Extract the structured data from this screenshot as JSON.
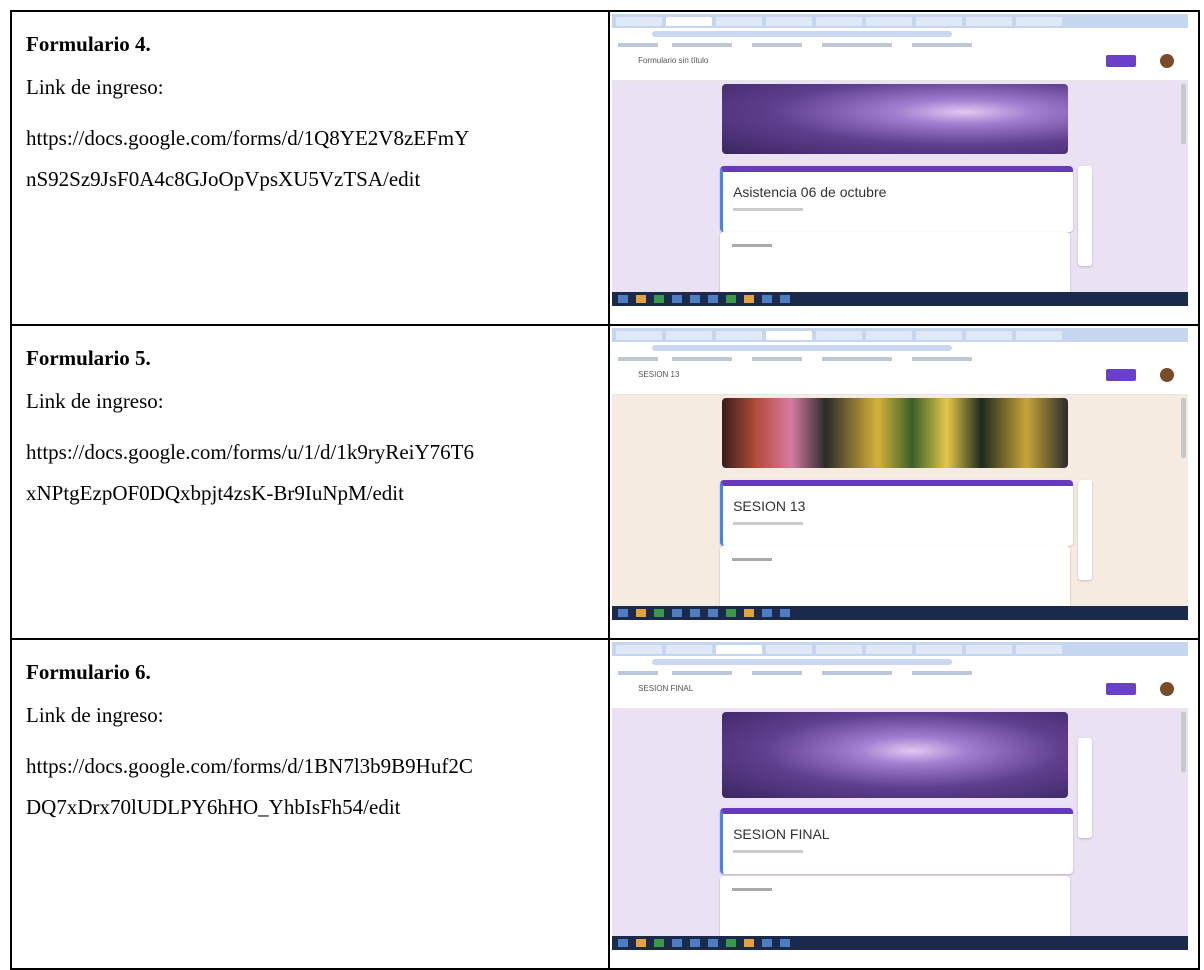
{
  "rows": [
    {
      "title": "Formulario 4.",
      "label": "Link de ingreso:",
      "url_line1": "https://docs.google.com/forms/d/1Q8YE2V8zEFmY",
      "url_line2": "nS92Sz9JsF0A4c8GJoOpVpsXU5VzTSA/edit",
      "screenshot": {
        "form_title": "Formulario sin título",
        "card_title": "Asistencia 06 de octubre",
        "background": "#eae1f3",
        "banner": "violet-flower"
      }
    },
    {
      "title": "Formulario 5.",
      "label": "Link de ingreso:",
      "url_line1": "https://docs.google.com/forms/u/1/d/1k9ryReiY76T6",
      "url_line2": "xNPtgEzpOF0DQxbpjt4zsK-Br9IuNpM/edit",
      "screenshot": {
        "form_title": "SESION 13",
        "card_title": "SESION 13",
        "background": "#f6ebe1",
        "banner": "colored-pencils"
      }
    },
    {
      "title": "Formulario 6.",
      "label": "Link de ingreso:",
      "url_line1": "https://docs.google.com/forms/d/1BN7l3b9B9Huf2C",
      "url_line2": "DQ7xDrx70lUDLPY6hHO_YhbIsFh54/edit",
      "screenshot": {
        "form_title": "SESION FINAL",
        "card_title": "SESION FINAL",
        "background": "#eae1f3",
        "banner": "violet-flower"
      }
    }
  ]
}
